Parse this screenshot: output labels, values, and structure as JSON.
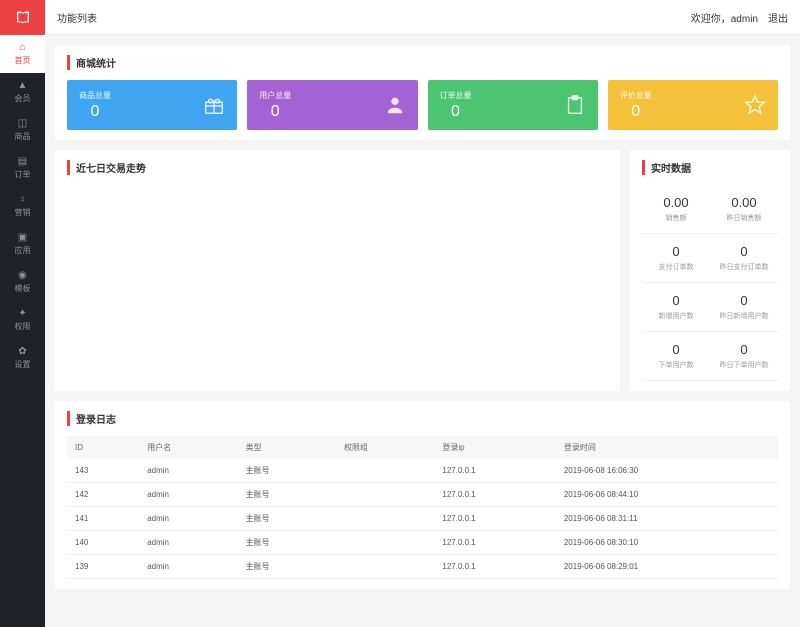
{
  "topbar": {
    "title": "功能列表",
    "welcome": "欢迎你，admin",
    "logout": "退出"
  },
  "sidebar": {
    "items": [
      {
        "label": "首页",
        "icon": "home"
      },
      {
        "label": "会员",
        "icon": "user"
      },
      {
        "label": "商品",
        "icon": "goods"
      },
      {
        "label": "订单",
        "icon": "order"
      },
      {
        "label": "营销",
        "icon": "marketing"
      },
      {
        "label": "应用",
        "icon": "app"
      },
      {
        "label": "模板",
        "icon": "template"
      },
      {
        "label": "权限",
        "icon": "permission"
      },
      {
        "label": "设置",
        "icon": "setting"
      }
    ]
  },
  "stats_panel": {
    "title": "商城统计"
  },
  "stats": [
    {
      "label": "商品总量",
      "value": "0"
    },
    {
      "label": "用户总量",
      "value": "0"
    },
    {
      "label": "订单总量",
      "value": "0"
    },
    {
      "label": "评价总量",
      "value": "0"
    }
  ],
  "chart": {
    "title": "近七日交易走势"
  },
  "realtime": {
    "title": "实时数据",
    "cells": [
      {
        "value": "0.00",
        "label": "销售额"
      },
      {
        "value": "0.00",
        "label": "昨日销售额"
      },
      {
        "value": "0",
        "label": "支付订单数"
      },
      {
        "value": "0",
        "label": "昨日支付订单数"
      },
      {
        "value": "0",
        "label": "新增用户数"
      },
      {
        "value": "0",
        "label": "昨日新增用户数"
      },
      {
        "value": "0",
        "label": "下单用户数"
      },
      {
        "value": "0",
        "label": "昨日下单用户数"
      }
    ]
  },
  "log": {
    "title": "登录日志",
    "headers": [
      "ID",
      "用户名",
      "类型",
      "权限组",
      "登录ip",
      "登录时间"
    ],
    "rows": [
      [
        "143",
        "admin",
        "主账号",
        "",
        "127.0.0.1",
        "2019-06-08 16:06:30"
      ],
      [
        "142",
        "admin",
        "主账号",
        "",
        "127.0.0.1",
        "2019-06-06 08:44:10"
      ],
      [
        "141",
        "admin",
        "主账号",
        "",
        "127.0.0.1",
        "2019-06-06 08:31:11"
      ],
      [
        "140",
        "admin",
        "主账号",
        "",
        "127.0.0.1",
        "2019-06-06 08:30:10"
      ],
      [
        "139",
        "admin",
        "主账号",
        "",
        "127.0.0.1",
        "2019-06-06 08:29:01"
      ]
    ]
  }
}
